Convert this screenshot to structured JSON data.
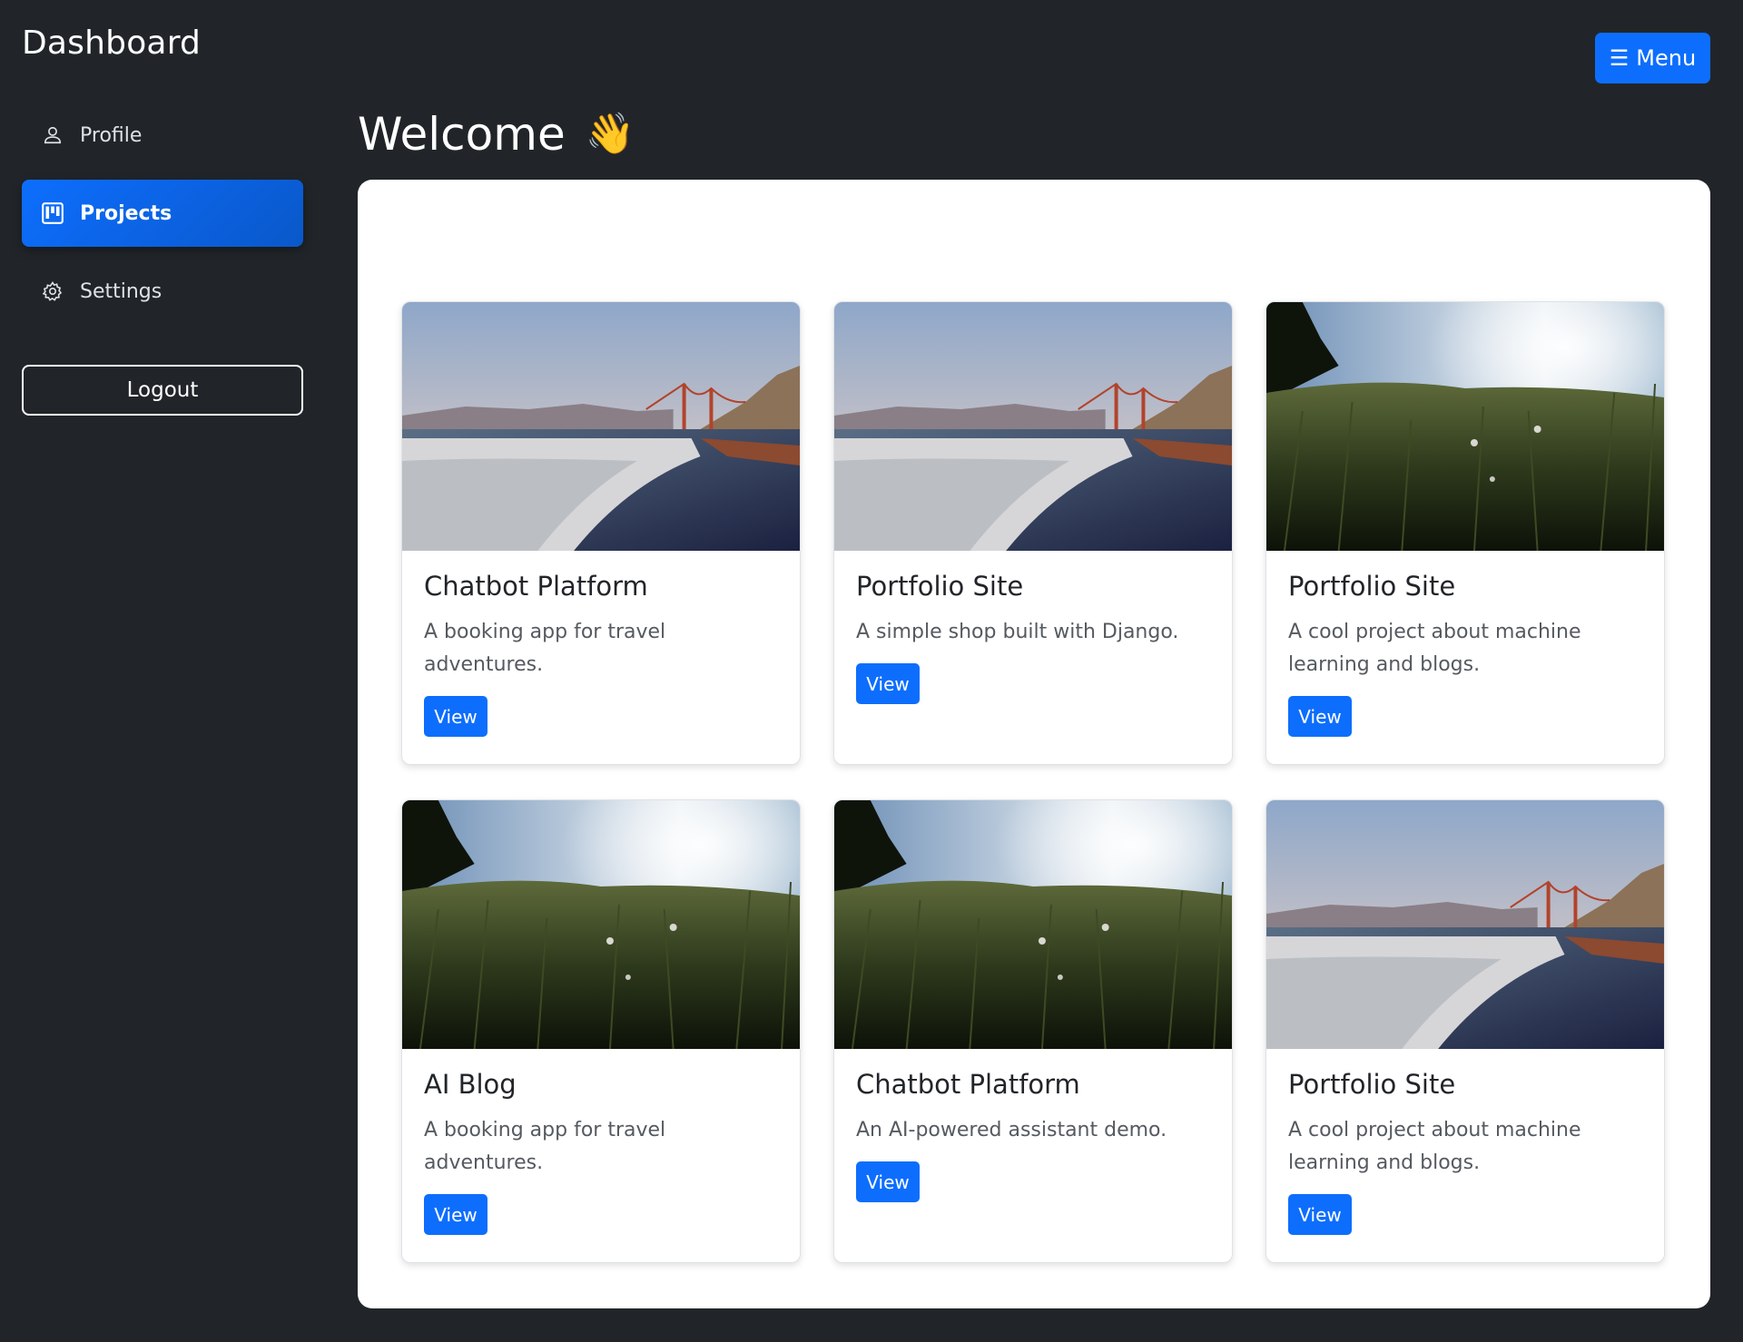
{
  "sidebar": {
    "brand": "Dashboard",
    "items": [
      {
        "label": "Profile",
        "icon": "person-icon",
        "active": false
      },
      {
        "label": "Projects",
        "icon": "kanban-icon",
        "active": true
      },
      {
        "label": "Settings",
        "icon": "gear-icon",
        "active": false
      }
    ],
    "logout_label": "Logout"
  },
  "header": {
    "menu_icon": "☰",
    "menu_label": "Menu"
  },
  "main": {
    "welcome": "Welcome",
    "welcome_emoji": "👋",
    "cards": [
      {
        "title": "Chatbot Platform",
        "description": "A booking app for travel adventures.",
        "button": "View",
        "image": "beach-bridge-image"
      },
      {
        "title": "Portfolio Site",
        "description": "A simple shop built with Django.",
        "button": "View",
        "image": "beach-bridge-image"
      },
      {
        "title": "Portfolio Site",
        "description": "A cool project about machine learning and blogs.",
        "button": "View",
        "image": "grass-field-image"
      },
      {
        "title": "AI Blog",
        "description": "A booking app for travel adventures.",
        "button": "View",
        "image": "grass-field-image"
      },
      {
        "title": "Chatbot Platform",
        "description": "An AI-powered assistant demo.",
        "button": "View",
        "image": "grass-field-image"
      },
      {
        "title": "Portfolio Site",
        "description": "A cool project about machine learning and blogs.",
        "button": "View",
        "image": "beach-bridge-image"
      }
    ]
  },
  "colors": {
    "background": "#212529",
    "primary": "#0d6efd",
    "panel": "#ffffff"
  }
}
